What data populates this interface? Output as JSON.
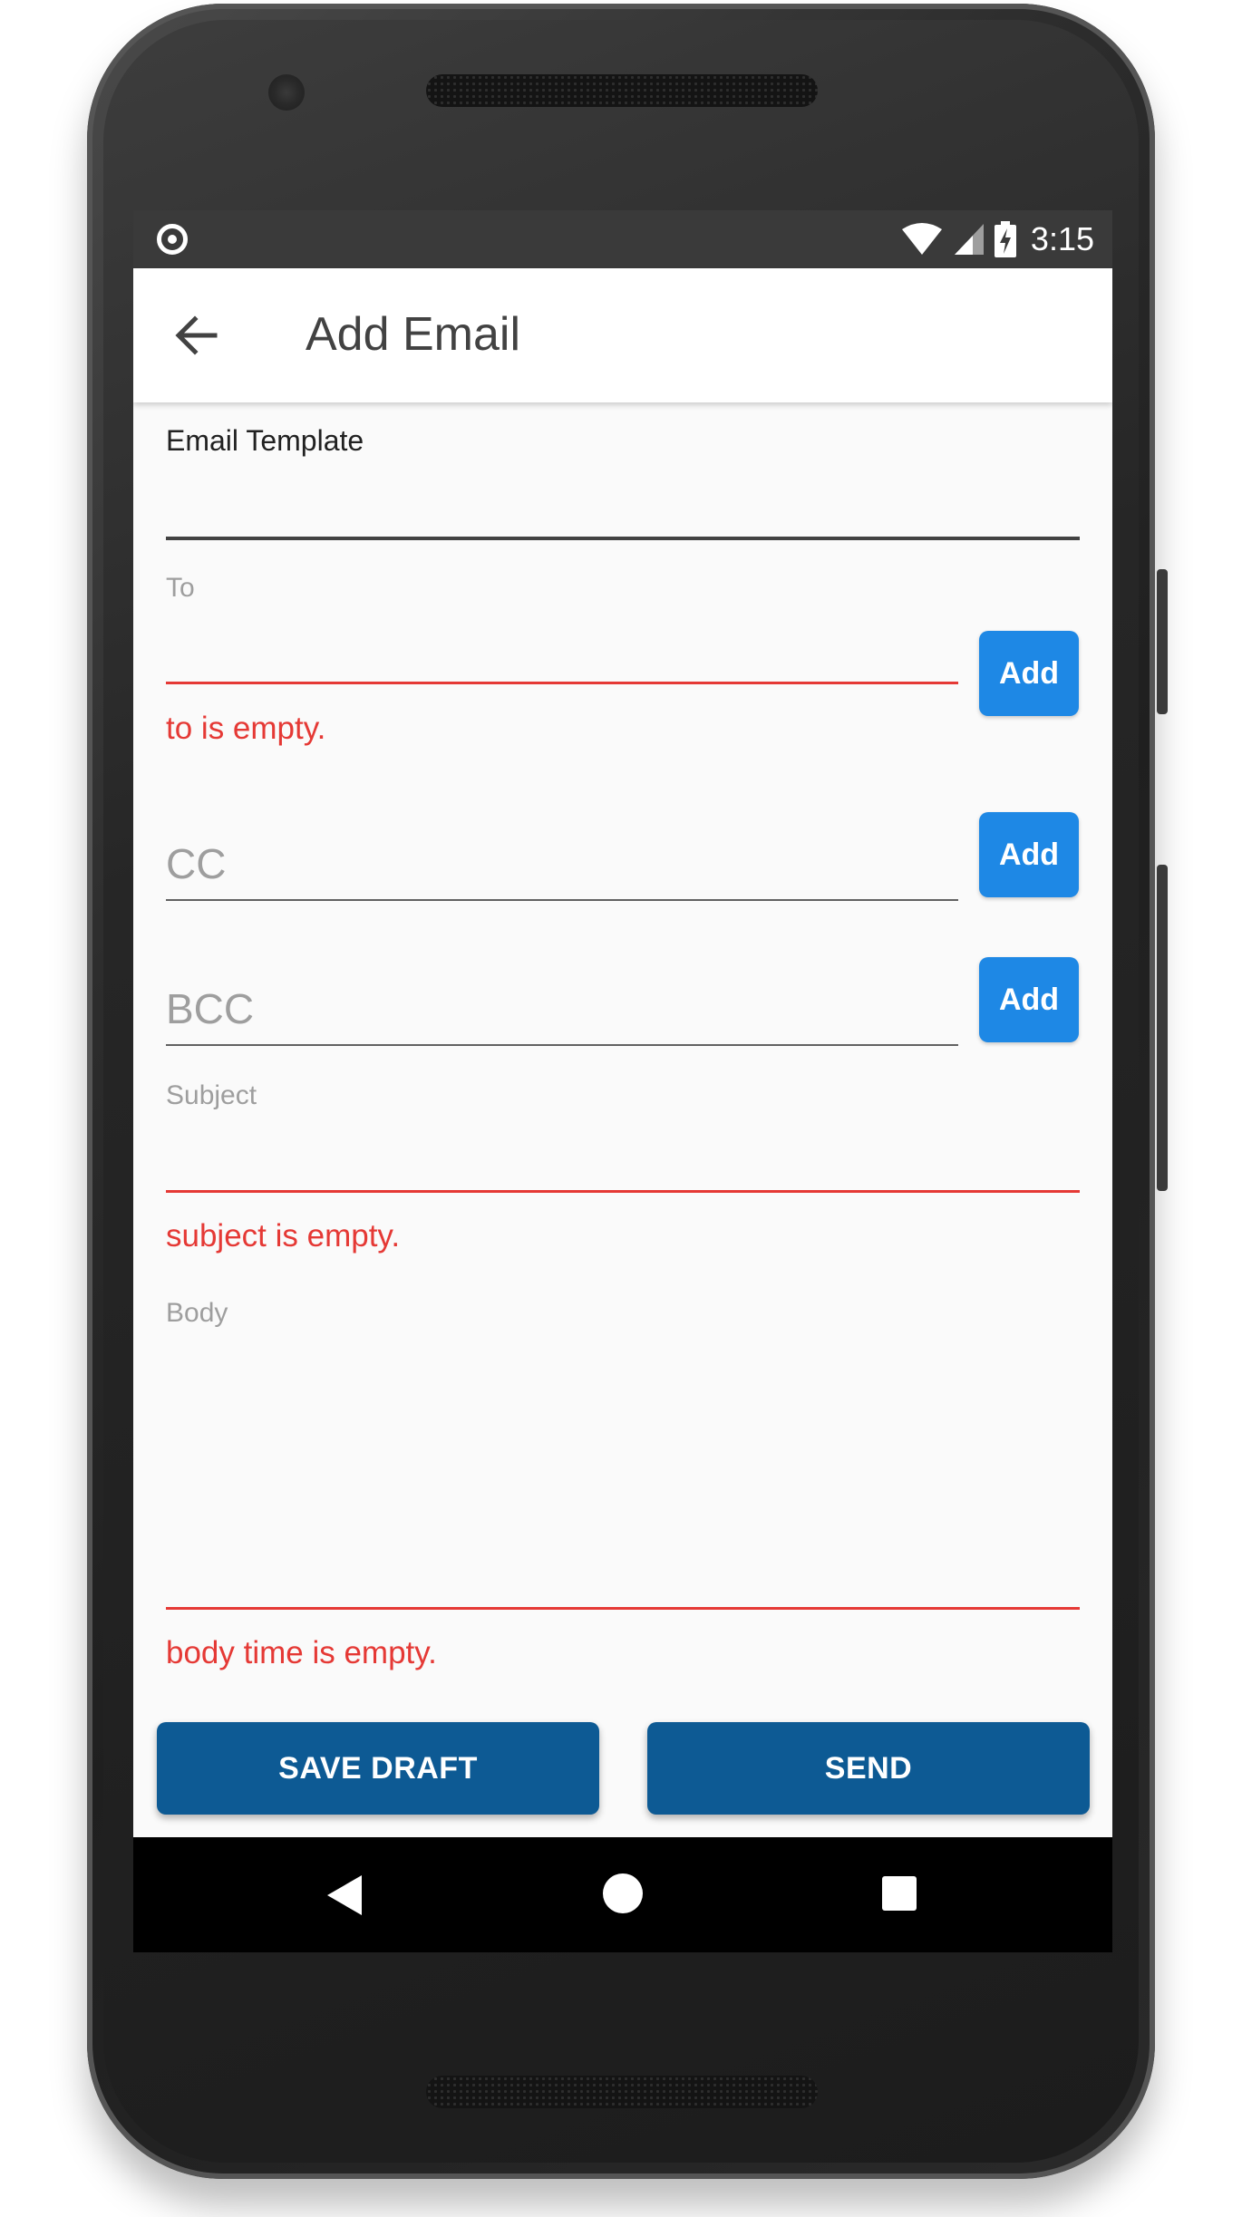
{
  "status_bar": {
    "time": "3:15",
    "icons": [
      "record-icon",
      "wifi-icon",
      "signal-icon",
      "battery-charging-icon"
    ]
  },
  "app_bar": {
    "title": "Add Email",
    "back_icon": "arrow-back-icon"
  },
  "form": {
    "email_template": {
      "label": "Email Template",
      "value": ""
    },
    "to": {
      "label": "To",
      "value": "",
      "error": "to is empty.",
      "add_label": "Add"
    },
    "cc": {
      "placeholder": "CC",
      "value": "",
      "add_label": "Add"
    },
    "bcc": {
      "placeholder": "BCC",
      "value": "",
      "add_label": "Add"
    },
    "subject": {
      "label": "Subject",
      "value": "",
      "error": "subject is empty."
    },
    "body": {
      "label": "Body",
      "value": "",
      "error": "body time is empty."
    }
  },
  "actions": {
    "save_draft_label": "SAVE DRAFT",
    "send_label": "SEND"
  },
  "nav_bar": {
    "icons": [
      "nav-back-icon",
      "nav-home-icon",
      "nav-recents-icon"
    ]
  },
  "colors": {
    "accent_button": "#1e88e5",
    "primary_button": "#0d5a94",
    "error": "#e53935",
    "status_bar": "#3a3a3a"
  }
}
